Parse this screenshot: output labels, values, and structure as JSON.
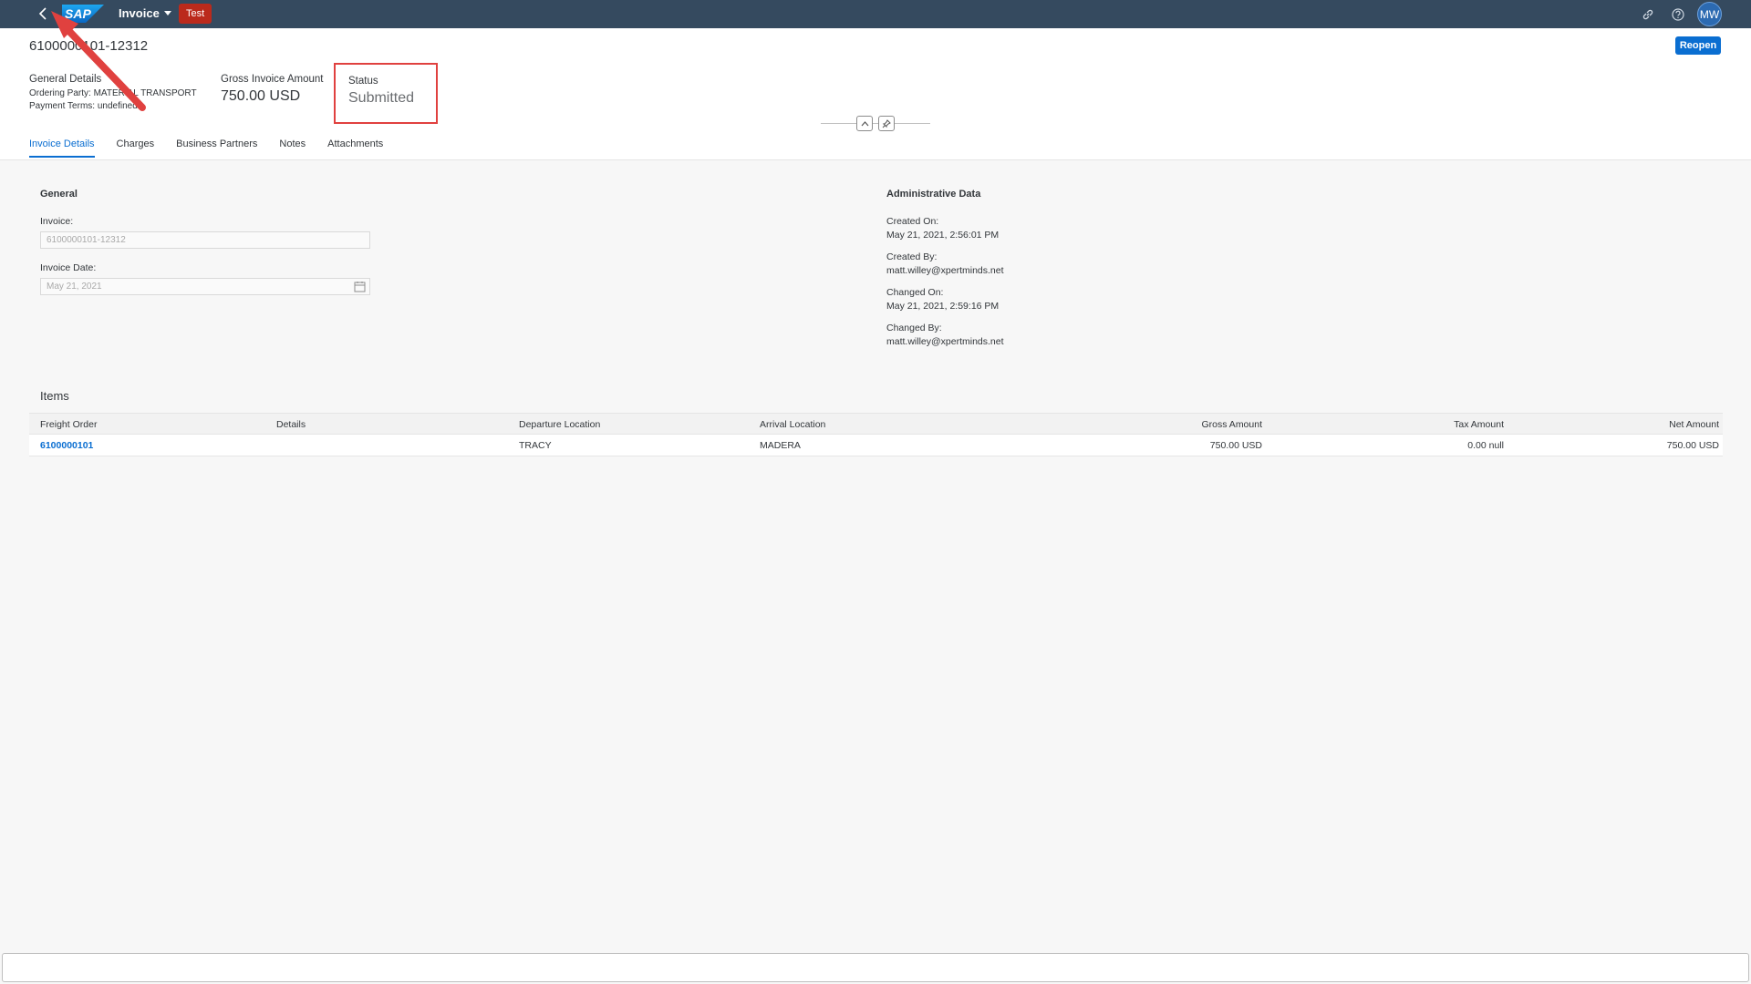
{
  "shell": {
    "logo_text": "SAP",
    "app_title": "Invoice",
    "environment": "Test",
    "avatar_initials": "MW"
  },
  "header": {
    "title": "6100000101-12312",
    "reopen_label": "Reopen",
    "general_details": {
      "label": "General Details",
      "ordering_party": "Ordering Party: MATERIAL TRANSPORT",
      "payment_terms": "Payment Terms: undefined"
    },
    "gross_amount": {
      "label": "Gross Invoice Amount",
      "value": "750.00 USD"
    },
    "status": {
      "label": "Status",
      "value": "Submitted"
    }
  },
  "tabs": [
    {
      "label": "Invoice Details",
      "active": true
    },
    {
      "label": "Charges"
    },
    {
      "label": "Business Partners"
    },
    {
      "label": "Notes"
    },
    {
      "label": "Attachments"
    }
  ],
  "general": {
    "heading": "General",
    "invoice_label": "Invoice:",
    "invoice_value": "6100000101-12312",
    "date_label": "Invoice Date:",
    "date_value": "May 21, 2021"
  },
  "admin": {
    "heading": "Administrative Data",
    "created_on_label": "Created On:",
    "created_on": "May 21, 2021, 2:56:01 PM",
    "created_by_label": "Created By:",
    "created_by": "matt.willey@xpertminds.net",
    "changed_on_label": "Changed On:",
    "changed_on": "May 21, 2021, 2:59:16 PM",
    "changed_by_label": "Changed By:",
    "changed_by": "matt.willey@xpertminds.net"
  },
  "items": {
    "title": "Items",
    "columns": [
      "Freight Order",
      "Details",
      "Departure Location",
      "Arrival Location",
      "Gross Amount",
      "Tax Amount",
      "Net Amount"
    ],
    "rows": [
      [
        "6100000101",
        "",
        "TRACY",
        "MADERA",
        "750.00 USD",
        "0.00 null",
        "750.00 USD"
      ]
    ]
  },
  "colors": {
    "shell": "#354a5f",
    "accent": "#0a6ed1",
    "env_badge": "#bb2a1c",
    "annotation": "#e0413f"
  }
}
